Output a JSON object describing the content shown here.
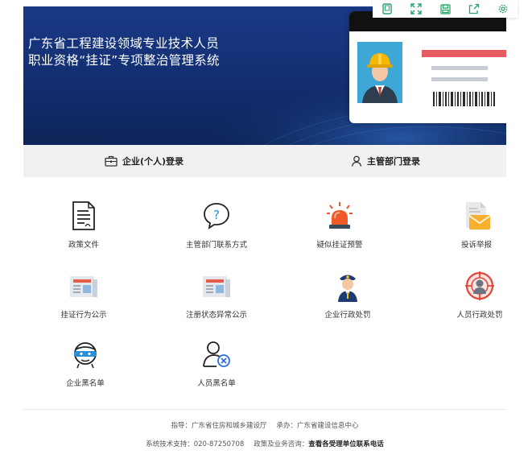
{
  "banner": {
    "title_line1": "广东省工程建设领域专业技术人员",
    "title_line2": "职业资格“挂证”专项整治管理系统"
  },
  "login": {
    "enterprise": "企业(个人)登录",
    "authority": "主管部门登录"
  },
  "tiles": [
    {
      "label": "政策文件",
      "icon": "document-icon"
    },
    {
      "label": "主管部门联系方式",
      "icon": "question-bubble-icon"
    },
    {
      "label": "疑似挂证预警",
      "icon": "alarm-light-icon"
    },
    {
      "label": "投诉举报",
      "icon": "envelope-icon"
    },
    {
      "label": "挂证行为公示",
      "icon": "newspaper-icon"
    },
    {
      "label": "注册状态异常公示",
      "icon": "newspaper-icon"
    },
    {
      "label": "企业行政处罚",
      "icon": "police-officer-icon"
    },
    {
      "label": "人员行政处罚",
      "icon": "target-person-icon"
    },
    {
      "label": "企业黑名单",
      "icon": "masked-face-icon"
    },
    {
      "label": "人员黑名单",
      "icon": "person-blocked-icon"
    }
  ],
  "footer": {
    "guide": "指导：广东省住房和城乡建设厅",
    "host": "承办：广东省建设信息中心",
    "tech_support": "系统技术支持：020-87250708",
    "policy_prefix": "政策及业务咨询：",
    "policy_link": "查看各受理单位联系电话"
  },
  "colors": {
    "banner": "#122d6f",
    "login_bar": "#f1f1f1",
    "toolbar_icon": "#2aa36b"
  }
}
